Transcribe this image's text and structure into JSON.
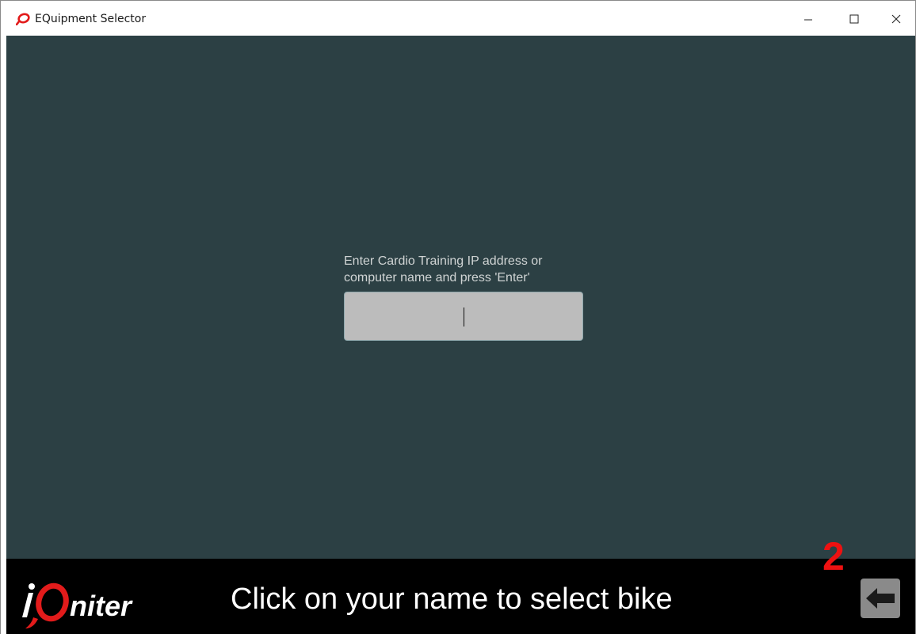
{
  "window": {
    "title": "EQuipment Selector",
    "icon": "iq-ring-logo-icon",
    "controls": {
      "minimize": "minimize-icon",
      "maximize": "maximize-icon",
      "close": "close-icon"
    }
  },
  "main": {
    "prompt": "Enter Cardio Training IP address or\ncomputer name and press 'Enter'",
    "ip_input_value": ""
  },
  "footer": {
    "logo_text": "iQniter",
    "message": "Click on your name to select bike",
    "annotation_number": "2",
    "back_button_icon": "arrow-left-icon"
  },
  "colors": {
    "background": "#2c4044",
    "input_background": "#bcbcbc",
    "footer_background": "#000000",
    "logo_accent": "#e21b1b",
    "annotation": "#ee1111"
  }
}
